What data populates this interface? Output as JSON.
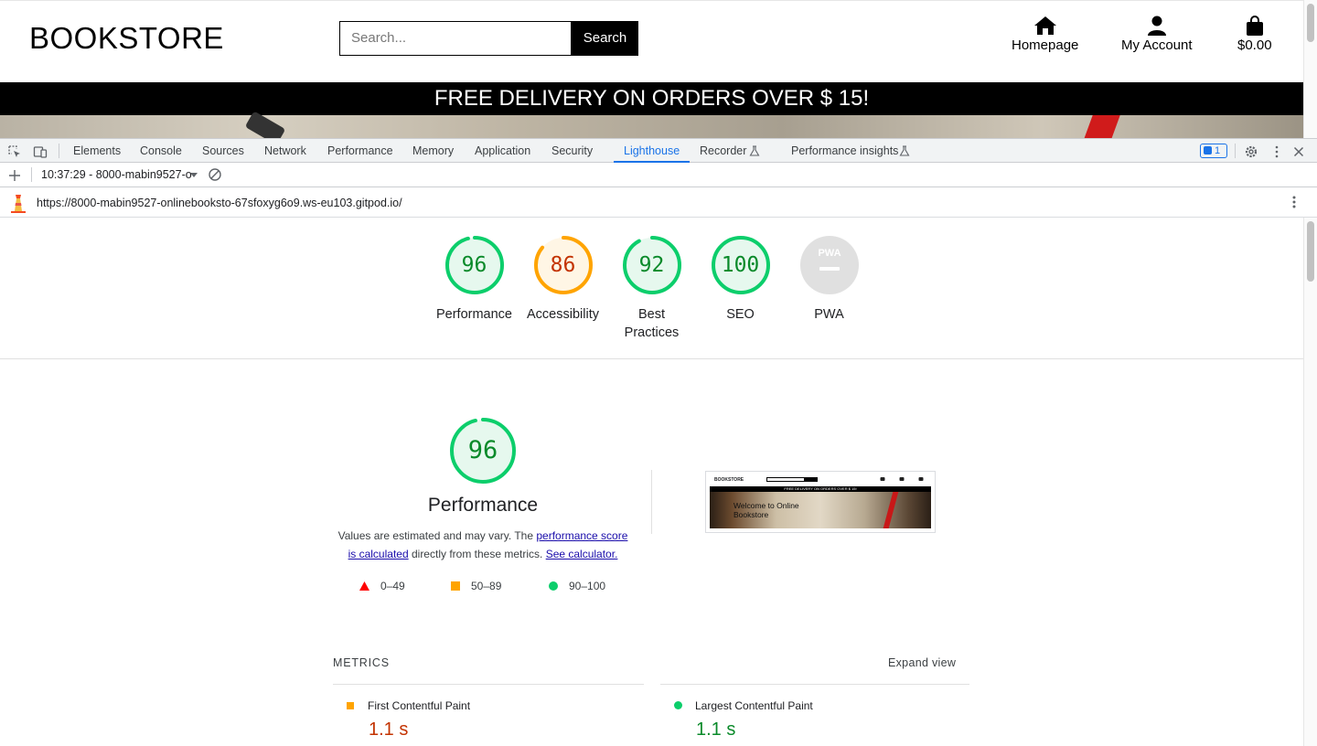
{
  "site": {
    "brand": "BOOKSTORE",
    "search_placeholder": "Search...",
    "search_button": "Search",
    "nav": [
      {
        "label": "Homepage",
        "icon": "home-icon"
      },
      {
        "label": "My Account",
        "icon": "user-icon"
      },
      {
        "label": "$0.00",
        "icon": "shopping-bag-icon"
      }
    ],
    "banner": "FREE DELIVERY ON ORDERS OVER $ 15!"
  },
  "devtools": {
    "tabs": [
      "Elements",
      "Console",
      "Sources",
      "Network",
      "Performance",
      "Memory",
      "Application",
      "Security",
      "Lighthouse",
      "Recorder",
      "Performance insights"
    ],
    "active_tab": "Lighthouse",
    "issues_count": "1",
    "report_select": "10:37:29 - 8000-mabin9527-o",
    "url": "https://8000-mabin9527-onlinebooksto-67sfoxyg6o9.ws-eu103.gitpod.io/"
  },
  "report": {
    "scores": [
      {
        "label": "Performance",
        "value": "96",
        "fraction": 0.96,
        "color": "#0cce6b",
        "text_color": "#0a8a2a",
        "bg": "#e6f8ee"
      },
      {
        "label": "Accessibility",
        "value": "86",
        "fraction": 0.86,
        "color": "#ffa400",
        "text_color": "#c33300",
        "bg": "#fff6e5"
      },
      {
        "label": "Best Practices",
        "value": "92",
        "fraction": 0.92,
        "color": "#0cce6b",
        "text_color": "#0a8a2a",
        "bg": "#e6f8ee"
      },
      {
        "label": "SEO",
        "value": "100",
        "fraction": 1.0,
        "color": "#0cce6b",
        "text_color": "#0a8a2a",
        "bg": "#e6f8ee"
      },
      {
        "label": "PWA",
        "value": "",
        "fraction": 0,
        "color": "#e0e0e0",
        "text_color": "#9e9e9e",
        "bg": "#e0e0e0"
      }
    ],
    "pwa_badge_text": "PWA",
    "performance": {
      "score": "96",
      "title": "Performance",
      "desc_prefix": "Values are estimated and may vary. The ",
      "desc_link1": "performance score is calculated",
      "desc_middle": " directly from these metrics. ",
      "desc_link2": "See calculator."
    },
    "legend": [
      {
        "range": "0–49",
        "shape": "triangle",
        "color": "#ff0000"
      },
      {
        "range": "50–89",
        "shape": "square",
        "color": "#ffa400"
      },
      {
        "range": "90–100",
        "shape": "circle",
        "color": "#0cce6b"
      }
    ],
    "thumbnail": {
      "brand": "BOOKSTORE",
      "banner": "FREE DELIVERY ON ORDERS OVER $ 15!",
      "hero_title": "Welcome to Online Bookstore"
    },
    "metrics_header": "METRICS",
    "expand_label": "Expand view",
    "metrics": [
      {
        "name": "First Contentful Paint",
        "value": "1.1 s",
        "marker": "square",
        "marker_color": "#ffa400",
        "value_color": "#c33300"
      },
      {
        "name": "Largest Contentful Paint",
        "value": "1.1 s",
        "marker": "circle",
        "marker_color": "#0cce6b",
        "value_color": "#0a8a2a"
      }
    ]
  }
}
